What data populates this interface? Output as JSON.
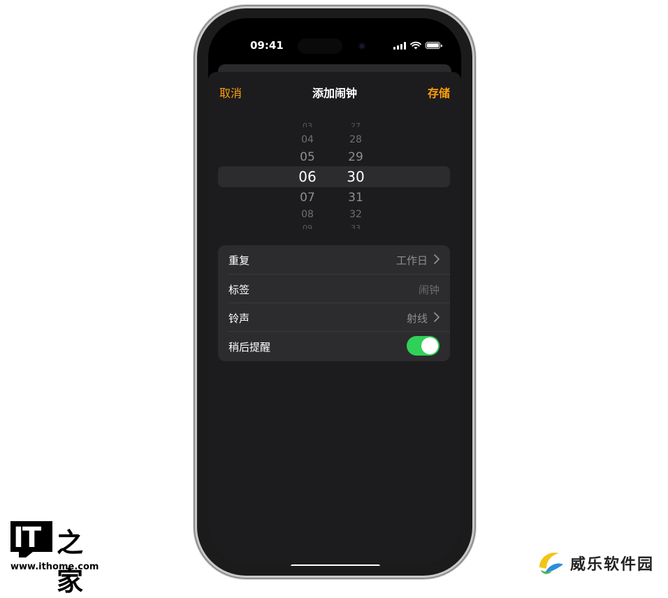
{
  "status_bar": {
    "time": "09:41"
  },
  "nav": {
    "cancel": "取消",
    "title": "添加闹钟",
    "save": "存储"
  },
  "picker": {
    "hours": [
      "03",
      "04",
      "05",
      "06",
      "07",
      "08",
      "09"
    ],
    "minutes": [
      "27",
      "28",
      "29",
      "30",
      "31",
      "32",
      "33"
    ],
    "selected_hour": "06",
    "selected_minute": "30"
  },
  "settings": {
    "repeat": {
      "label": "重复",
      "value": "工作日"
    },
    "tag": {
      "label": "标签",
      "placeholder": "闹钟"
    },
    "sound": {
      "label": "铃声",
      "value": "射线"
    },
    "snooze": {
      "label": "稍后提醒",
      "enabled": true
    }
  },
  "watermarks": {
    "ithome_url": "www.ithome.com",
    "ithome_logo_text": "IT之家",
    "weile_brand": "威乐软件园"
  },
  "colors": {
    "accent": "#ff9f0a",
    "toggle_on": "#30d158",
    "sheet": "#1c1c1e",
    "cell": "#2c2c2e"
  }
}
